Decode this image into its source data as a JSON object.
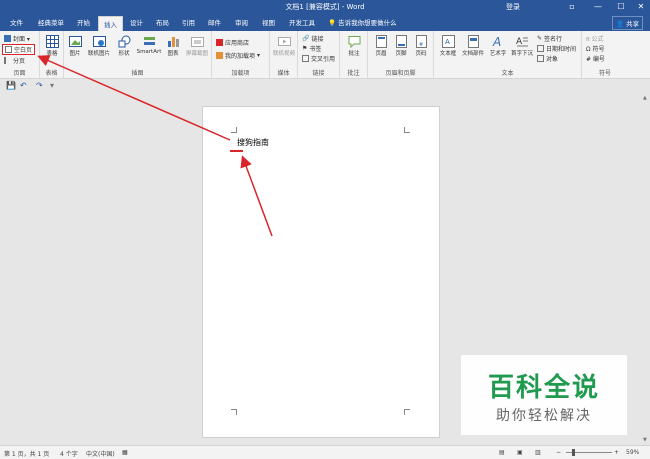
{
  "window": {
    "title": "文档1 [兼容模式] - Word",
    "login": "登录",
    "buttons": [
      "▫",
      "—",
      "☐",
      "✕"
    ]
  },
  "tabs": [
    {
      "label": "文件",
      "active": false
    },
    {
      "label": "经典菜单",
      "active": false
    },
    {
      "label": "开始",
      "active": false
    },
    {
      "label": "插入",
      "active": true
    },
    {
      "label": "设计",
      "active": false
    },
    {
      "label": "布局",
      "active": false
    },
    {
      "label": "引用",
      "active": false
    },
    {
      "label": "邮件",
      "active": false
    },
    {
      "label": "审阅",
      "active": false
    },
    {
      "label": "视图",
      "active": false
    },
    {
      "label": "开发工具",
      "active": false
    }
  ],
  "tellme": "告诉我你想要做什么",
  "share": "共享",
  "ribbon": {
    "pages": {
      "label": "页面",
      "cover": "封面 ▾",
      "blank_page": "空白页",
      "page_break": "分页"
    },
    "tables": {
      "label": "表格",
      "table": "表格"
    },
    "illustrations": {
      "label": "插图",
      "picture": "图片",
      "online_picture": "联机图片",
      "shapes": "形状",
      "smartart": "SmartArt",
      "chart": "图表",
      "screenshot": "屏幕截图"
    },
    "addins": {
      "label": "加载项",
      "store": "应用商店",
      "my_addins": "我的加载项"
    },
    "media": {
      "label": "媒体",
      "online_video": "联机视频"
    },
    "links": {
      "label": "链接",
      "link": "链接",
      "bookmark": "书签",
      "cross_ref": "交叉引用"
    },
    "comments": {
      "label": "批注",
      "comment": "批注"
    },
    "header_footer": {
      "label": "页眉和页脚",
      "header": "页眉",
      "footer": "页脚",
      "page_number": "页码"
    },
    "text": {
      "label": "文本",
      "textbox": "文本框",
      "quick_parts": "文档部件",
      "wordart": "艺术字",
      "dropcap": "首字下沉",
      "signature": "签名行",
      "datetime": "日期和时间",
      "object": "对象"
    },
    "symbols": {
      "label": "符号",
      "equation": "π 公式",
      "symbol": "Ω 符号",
      "number": "# 编号"
    }
  },
  "document": {
    "text": "搜狗指南"
  },
  "status": {
    "page": "第 1 页，共 1 页",
    "words": "4 个字",
    "language": "中文(中国)",
    "zoom": "59%"
  },
  "watermark": {
    "big": "百科全说",
    "small": "助你轻松解决"
  },
  "colors": {
    "accent": "#2b579a",
    "annotation": "#d9262b",
    "watermark": "#1f9a4f"
  }
}
